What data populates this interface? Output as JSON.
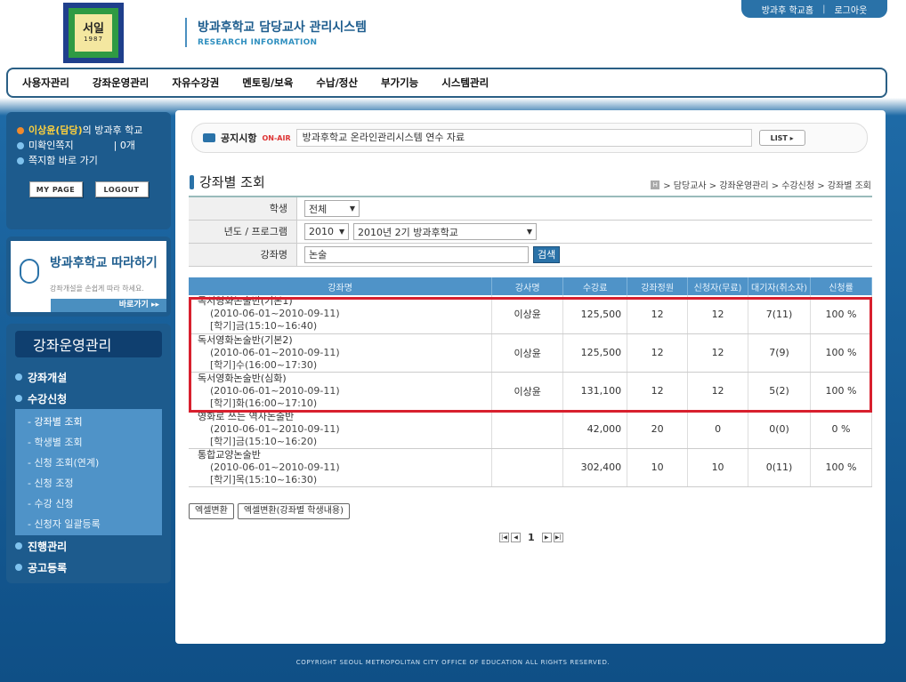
{
  "header": {
    "logo_text": "서일",
    "logo_sub": "1987",
    "title": "방과후학교 담당교사 관리시스템",
    "subtitle": "RESEARCH INFORMATION",
    "links": [
      "방과후 학교홈",
      "로그아웃"
    ]
  },
  "gnb": [
    "사용자관리",
    "강좌운영관리",
    "자유수강권",
    "멘토링/보육",
    "수납/정산",
    "부가기능",
    "시스템관리"
  ],
  "user": {
    "name": "이상윤(담당)",
    "suffix": "의 방과후 학교",
    "unread_label": "미확인쪽지",
    "unread_count": "0개",
    "inbox_label": "쪽지함 바로 가기",
    "mypage": "MY PAGE",
    "logout": "LOGOUT"
  },
  "banner": {
    "title": "방과후학교 따라하기",
    "desc": "강좌개설을 손쉽게 따라 하세요.",
    "go": "바로가기 ▸▸"
  },
  "lnb": {
    "title": "강좌운영관리",
    "items": [
      "강좌개설",
      "수강신청",
      "진행관리",
      "공고등록"
    ],
    "subs": [
      "- 강좌별 조회",
      "- 학생별 조회",
      "- 신청 조회(연계)",
      "- 신청 조정",
      "- 수강 신청",
      "- 신청자 일괄등록"
    ]
  },
  "notice": {
    "label": "공지시항",
    "onair": "ON-AIR",
    "text": "방과후학교 온라인관리시스템 연수 자료",
    "list": "LIST ▸"
  },
  "page": {
    "title": "강좌별 조회",
    "breadcrumb": "> 담당교사 > 강좌운영관리 > 수강신청 > 강좌별 조회"
  },
  "form": {
    "student_label": "학생",
    "student_value": "전체",
    "year_label": "년도 / 프로그램",
    "year_value": "2010",
    "program_value": "2010년 2기 방과후학교",
    "course_label": "강좌명",
    "course_value": "논술",
    "search_btn": "검색"
  },
  "table": {
    "headers": [
      "강좌명",
      "강사명",
      "수강료",
      "강좌정원",
      "신청자(무료)",
      "대기자(취소자)",
      "신청률"
    ],
    "rows": [
      {
        "name": "독서영화논술반(기본1)",
        "period": "(2010-06-01~2010-09-11)",
        "time": "[학기]금(15:10~16:40)",
        "teacher": "이상윤",
        "fee": "125,500",
        "cap": "12",
        "app": "12",
        "wait": "7(11)",
        "rate": "100 %"
      },
      {
        "name": "독서영화논술반(기본2)",
        "period": "(2010-06-01~2010-09-11)",
        "time": "[학기]수(16:00~17:30)",
        "teacher": "이상윤",
        "fee": "125,500",
        "cap": "12",
        "app": "12",
        "wait": "7(9)",
        "rate": "100 %"
      },
      {
        "name": "독서영화논술반(심화)",
        "period": "(2010-06-01~2010-09-11)",
        "time": "[학기]화(16:00~17:10)",
        "teacher": "이상윤",
        "fee": "131,100",
        "cap": "12",
        "app": "12",
        "wait": "5(2)",
        "rate": "100 %"
      },
      {
        "name": "영화로 쓰는 역사논술반",
        "period": "(2010-06-01~2010-09-11)",
        "time": "[학기]금(15:10~16:20)",
        "teacher": "",
        "fee": "42,000",
        "cap": "20",
        "app": "0",
        "wait": "0(0)",
        "rate": "0 %"
      },
      {
        "name": "통합교양논술반",
        "period": "(2010-06-01~2010-09-11)",
        "time": "[학기]목(15:10~16:30)",
        "teacher": "",
        "fee": "302,400",
        "cap": "10",
        "app": "10",
        "wait": "0(11)",
        "rate": "100 %"
      }
    ]
  },
  "buttons": {
    "excel": "엑셀변환",
    "excel_students": "엑셀변환(강좌별 학생내용)"
  },
  "paging": {
    "current": "1"
  },
  "footer": "COPYRIGHT SEOUL METROPOLITAN CITY OFFICE OF EDUCATION ALL RIGHTS RESERVED.",
  "colors": {
    "accent": "#2a72a8",
    "nav_dark": "#1d5b8d",
    "highlight": "#d8202e"
  }
}
